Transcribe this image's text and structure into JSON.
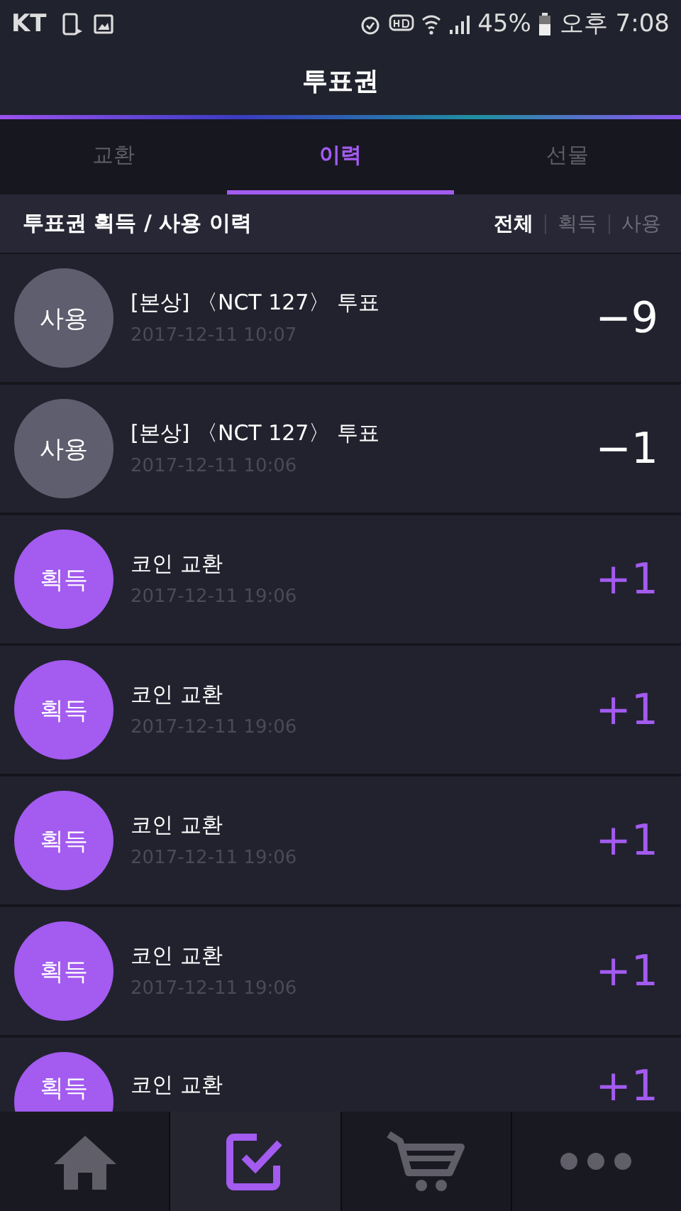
{
  "status_bar": {
    "carrier": "KT",
    "battery": "45%",
    "time": "오후 7:08"
  },
  "header": {
    "title": "투표권"
  },
  "tabs": [
    {
      "label": "교환",
      "selected": false
    },
    {
      "label": "이력",
      "selected": true
    },
    {
      "label": "선물",
      "selected": false
    }
  ],
  "section": {
    "title": "투표권 획득 / 사용 이력",
    "filters": [
      {
        "label": "전체",
        "selected": true
      },
      {
        "label": "획득",
        "selected": false
      },
      {
        "label": "사용",
        "selected": false
      }
    ]
  },
  "history": [
    {
      "kind": "use",
      "badge": "사용",
      "title": "[본상] 〈NCT 127〉 투표",
      "date": "2017-12-11 10:07",
      "amount": "−9"
    },
    {
      "kind": "use",
      "badge": "사용",
      "title": "[본상] 〈NCT 127〉 투표",
      "date": "2017-12-11 10:06",
      "amount": "−1"
    },
    {
      "kind": "gain",
      "badge": "획득",
      "title": "코인 교환",
      "date": "2017-12-11 19:06",
      "amount": "+1"
    },
    {
      "kind": "gain",
      "badge": "획득",
      "title": "코인 교환",
      "date": "2017-12-11 19:06",
      "amount": "+1"
    },
    {
      "kind": "gain",
      "badge": "획득",
      "title": "코인 교환",
      "date": "2017-12-11 19:06",
      "amount": "+1"
    },
    {
      "kind": "gain",
      "badge": "획득",
      "title": "코인 교환",
      "date": "2017-12-11 19:06",
      "amount": "+1"
    },
    {
      "kind": "gain",
      "badge": "획득",
      "title": "코인 교환",
      "amount": "+1"
    }
  ],
  "bottom_nav": [
    {
      "kind": "home",
      "selected": false
    },
    {
      "kind": "vote",
      "selected": true
    },
    {
      "kind": "cart",
      "selected": false
    },
    {
      "kind": "more",
      "selected": false
    }
  ]
}
